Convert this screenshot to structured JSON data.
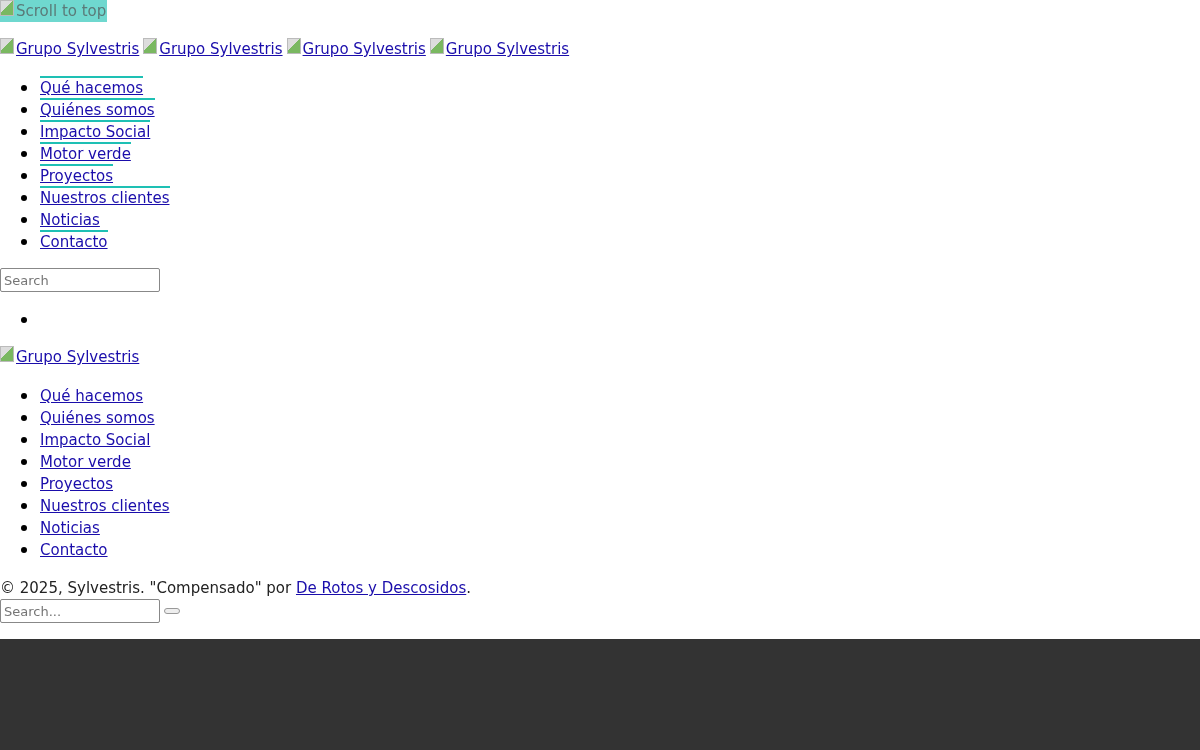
{
  "scroll_top": {
    "alt": "Scroll to top"
  },
  "logos": [
    "Grupo Sylvestris",
    "Grupo Sylvestris",
    "Grupo Sylvestris",
    "Grupo Sylvestris"
  ],
  "main_menu": [
    {
      "label": "Qué hacemos",
      "accent": true
    },
    {
      "label": "Quiénes somos",
      "accent": true
    },
    {
      "label": "Impacto Social",
      "accent": true
    },
    {
      "label": "Motor verde",
      "accent": true
    },
    {
      "label": "Proyectos",
      "accent": true
    },
    {
      "label": "Nuestros clientes",
      "accent": true
    },
    {
      "label": "Noticias",
      "accent": false
    },
    {
      "label": "Contacto",
      "accent": true
    }
  ],
  "search": {
    "placeholder": "Search"
  },
  "footer_logo": "Grupo Sylvestris",
  "footer_menu": [
    "Qué hacemos",
    "Quiénes somos",
    "Impacto Social",
    "Motor verde",
    "Proyectos",
    "Nuestros clientes",
    "Noticias",
    "Contacto"
  ],
  "credit": {
    "text": "© 2025, Sylvestris. \"Compensado\" por ",
    "link": "De Rotos y Descosidos",
    "end": "."
  },
  "footer_search": {
    "placeholder": "Search..."
  }
}
